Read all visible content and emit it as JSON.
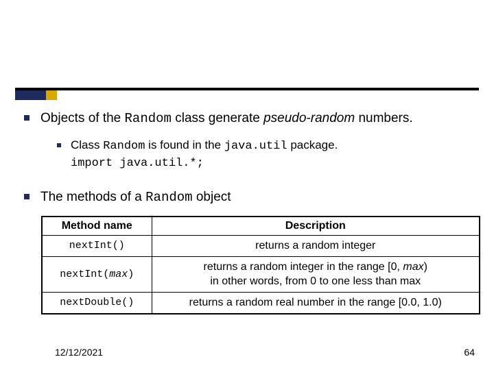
{
  "bullet1": {
    "prefix": "Objects of the ",
    "code": "Random",
    "mid": " class generate ",
    "italic": "pseudo-random",
    "suffix": " numbers."
  },
  "subbullet": {
    "line1_prefix": "Class ",
    "line1_code": "Random",
    "line1_mid": " is found in the ",
    "line1_code2": "java.util",
    "line1_suffix": " package.",
    "line2": "import java.util.*;"
  },
  "bullet2": {
    "prefix": "The methods of a ",
    "code": "Random",
    "suffix": " object"
  },
  "table": {
    "headers": {
      "method": "Method name",
      "desc": "Description"
    },
    "rows": [
      {
        "method": "nextInt()",
        "desc": "returns a random integer"
      },
      {
        "method_prefix": "nextInt(",
        "method_italic": "max",
        "method_suffix": ")",
        "desc_line1_prefix": "returns a random integer in the range [0, ",
        "desc_line1_italic": "max",
        "desc_line1_suffix": ")",
        "desc_line2": "in other words, from 0 to one less than max"
      },
      {
        "method": "nextDouble()",
        "desc": "returns a random real number in the range [0.0, 1.0)"
      }
    ]
  },
  "footer": {
    "date": "12/12/2021",
    "page": "64"
  }
}
